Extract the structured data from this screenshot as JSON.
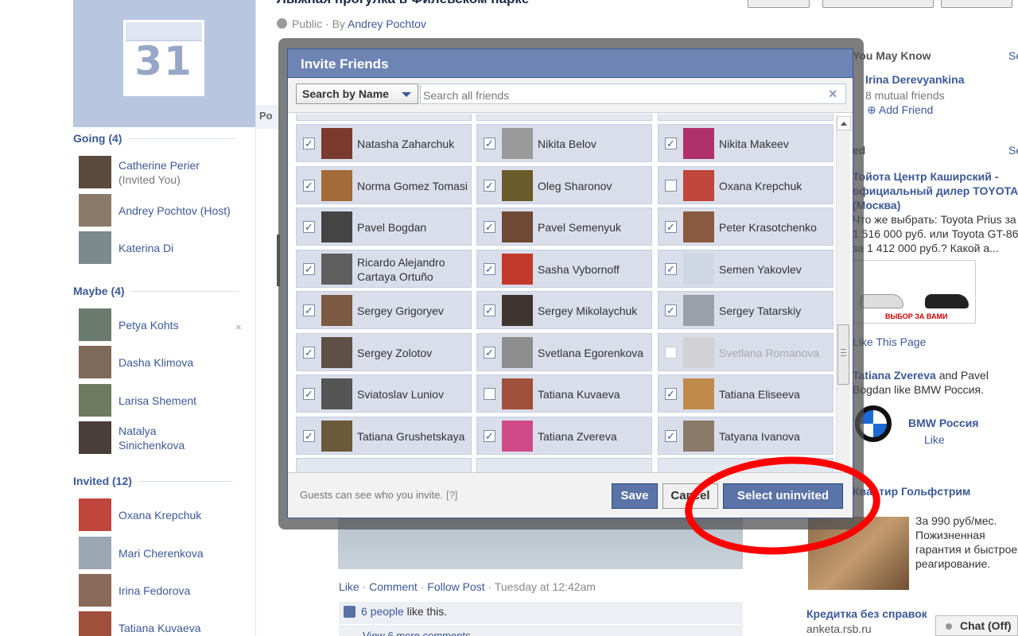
{
  "event": {
    "title": "Лыжная прогулка в Филёвском парке",
    "privacy": "Public",
    "by_prefix": "· By",
    "host_name": "Andrey Pochtov",
    "calendar_day": "31",
    "post_tab_label": "Po"
  },
  "guests": {
    "going": {
      "title": "Going (4)",
      "people": [
        {
          "name": "Catherine Perier",
          "note": "(Invited You)"
        },
        {
          "name": "Andrey Pochtov (Host)",
          "note": ""
        },
        {
          "name": "Katerina Di",
          "note": ""
        }
      ]
    },
    "maybe": {
      "title": "Maybe (4)",
      "people": [
        {
          "name": "Petya Kohts"
        },
        {
          "name": "Dasha Klimova"
        },
        {
          "name": "Larisa Shement"
        },
        {
          "name": "Natalya Sinichenkova"
        }
      ],
      "remove_icon": "×"
    },
    "invited": {
      "title": "Invited (12)",
      "people": [
        {
          "name": "Oxana Krepchuk"
        },
        {
          "name": "Mari Cherenkova"
        },
        {
          "name": "Irina Fedorova"
        },
        {
          "name": "Tatiana Kuvaeva"
        }
      ]
    }
  },
  "post": {
    "actions": {
      "like": "Like",
      "comment": "Comment",
      "follow": "Follow Post",
      "time": "Tuesday at 12:42am",
      "sep": "·"
    },
    "likes": {
      "count": "6 people",
      "suffix": "like this."
    },
    "more_comments": "View 6 more comments"
  },
  "right_column": {
    "pymk_title": "You May Know",
    "pymk_see": "Se",
    "pymk_name": "Irina Derevyankina",
    "pymk_mutual": "8 mutual friends",
    "pymk_add": "Add Friend",
    "sponsored_title": "ed",
    "sponsored_see": "Se",
    "ad1_title": "Тойота Центр Каширский - официальный дилер TOYOTA (Москва)",
    "ad1_body": "Что же выбрать: Toyota Prius за 1 516 000 руб. или Toyota GT-86 за 1 412 000 руб.? Какой а...",
    "ad1_image_caption": "ВЫБОР ЗА ВАМИ",
    "ad1_like": "Like This Page",
    "social_1": "Tatiana Zvereva",
    "social_and": "and Pavel Bogdan like BMW Россия.",
    "bmw_name": "BMW Россия",
    "bmw_like": "Like",
    "ad2_title": "Квартир Гольфстрим",
    "ad2_body": "За 990 руб/мес. Пожизненная гарантия и быстрое реагирование.",
    "ad3_title": "Кредитка без справок",
    "ad3_url": "anketa.rsb.ru",
    "chat": "Chat (Off)"
  },
  "dialog": {
    "title": "Invite Friends",
    "filter_label": "Search by Name",
    "search_placeholder": "Search all friends",
    "clear_icon": "×",
    "friends": [
      {
        "name": "Natasha Zaharchuk",
        "checked": true,
        "enabled": true,
        "color": "#7a3b2e"
      },
      {
        "name": "Nikita Belov",
        "checked": true,
        "enabled": true,
        "color": "#9a9a9a"
      },
      {
        "name": "Nikita Makeev",
        "checked": true,
        "enabled": true,
        "color": "#b0306a"
      },
      {
        "name": "Norma Gomez Tomasi",
        "checked": true,
        "enabled": true,
        "color": "#a36a3a"
      },
      {
        "name": "Oleg Sharonov",
        "checked": true,
        "enabled": true,
        "color": "#6b5a2a"
      },
      {
        "name": "Oxana Krepchuk",
        "checked": false,
        "enabled": true,
        "color": "#c0453a"
      },
      {
        "name": "Pavel Bogdan",
        "checked": true,
        "enabled": true,
        "color": "#444444"
      },
      {
        "name": "Pavel Semenyuk",
        "checked": true,
        "enabled": true,
        "color": "#6e4a36"
      },
      {
        "name": "Peter Krasotchenko",
        "checked": true,
        "enabled": true,
        "color": "#8a5a40"
      },
      {
        "name": "Ricardo Alejandro Cartaya Ortuño",
        "checked": true,
        "enabled": true,
        "color": "#5e5e5e"
      },
      {
        "name": "Sasha Vybornoff",
        "checked": true,
        "enabled": true,
        "color": "#c2382a"
      },
      {
        "name": "Semen Yakovlev",
        "checked": true,
        "enabled": true,
        "color": "#cfd6e4"
      },
      {
        "name": "Sergey Grigoryev",
        "checked": true,
        "enabled": true,
        "color": "#7b5a44"
      },
      {
        "name": "Sergey Mikolaychuk",
        "checked": true,
        "enabled": true,
        "color": "#3f3530"
      },
      {
        "name": "Sergey Tatarskiy",
        "checked": true,
        "enabled": true,
        "color": "#9aa0a8"
      },
      {
        "name": "Sergey Zolotov",
        "checked": true,
        "enabled": true,
        "color": "#5f5046"
      },
      {
        "name": "Svetlana Egorenkova",
        "checked": true,
        "enabled": true,
        "color": "#8e8e8e"
      },
      {
        "name": "Svetlana Romanova",
        "checked": false,
        "enabled": false,
        "color": "#c9c3bd"
      },
      {
        "name": "Sviatoslav Luniov",
        "checked": true,
        "enabled": true,
        "color": "#555555"
      },
      {
        "name": "Tatiana Kuvaeva",
        "checked": false,
        "enabled": true,
        "color": "#a0503a"
      },
      {
        "name": "Tatiana Eliseeva",
        "checked": true,
        "enabled": true,
        "color": "#c08a4a"
      },
      {
        "name": "Tatiana Grushetskaya",
        "checked": true,
        "enabled": true,
        "color": "#6a5a3a"
      },
      {
        "name": "Tatiana Zvereva",
        "checked": true,
        "enabled": true,
        "color": "#d04a8a"
      },
      {
        "name": "Tatyana Ivanova",
        "checked": true,
        "enabled": true,
        "color": "#8a7a6a"
      }
    ],
    "footer_note": "Guests can see who you invite.",
    "footer_help": "[?]",
    "save": "Save",
    "cancel": "Cancel",
    "select_uninvited": "Select uninvited"
  }
}
